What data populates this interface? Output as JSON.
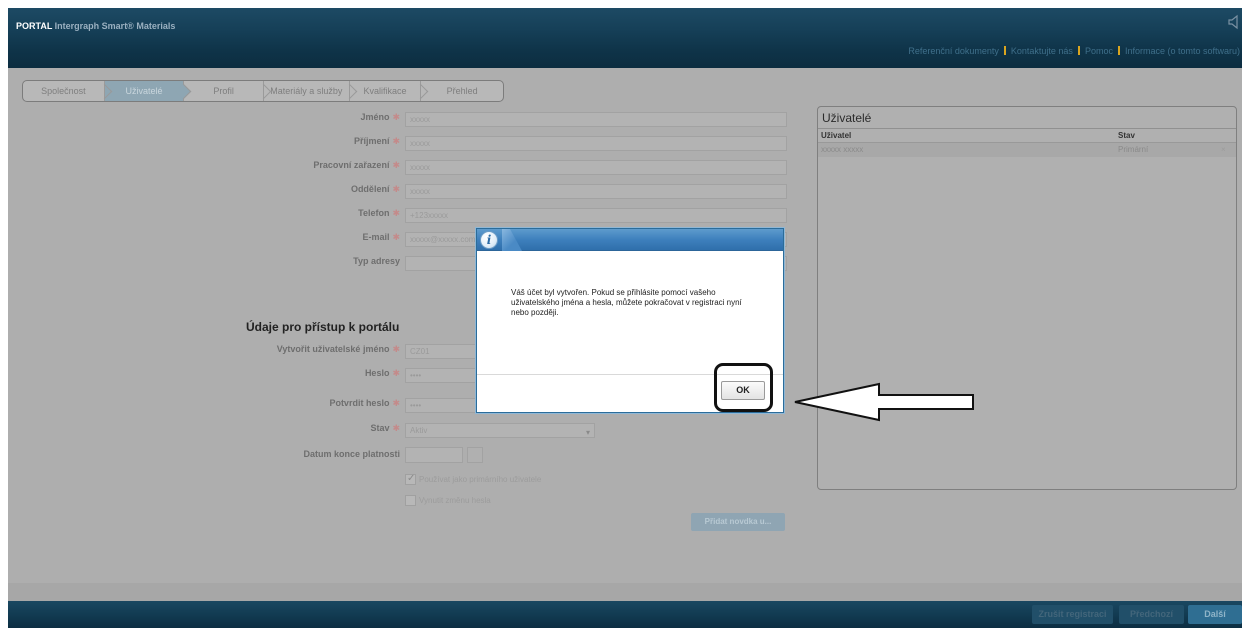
{
  "header": {
    "brand_prefix": "PORTAL",
    "brand_rest": " Intergraph Smart® Materials",
    "links": [
      "Referenční dokumenty",
      "Kontaktujte nás",
      "Pomoc",
      "Informace (o tomto softwaru)"
    ],
    "icon": "speaker-icon"
  },
  "wizard": {
    "steps": [
      "Společnost",
      "Uživatelé",
      "Profil",
      "Materiály a služby",
      "Kvalifikace",
      "Přehled"
    ],
    "active": "Uživatelé"
  },
  "form": {
    "fields": [
      {
        "label": "Jméno",
        "required": true,
        "placeholder": "xxxxx"
      },
      {
        "label": "Příjmení",
        "required": true,
        "placeholder": "xxxxx"
      },
      {
        "label": "Pracovní zařazení",
        "required": true,
        "placeholder": "xxxxx"
      },
      {
        "label": "Oddělení",
        "required": true,
        "placeholder": "xxxxx"
      },
      {
        "label": "Telefon",
        "required": true,
        "placeholder": "+123xxxxx"
      },
      {
        "label": "E-mail",
        "required": true,
        "placeholder": "xxxxx@xxxxx.com"
      },
      {
        "label": "Typ adresy",
        "required": false,
        "placeholder": ""
      }
    ],
    "access_section_title": "Údaje pro přístup k portálu",
    "access_fields": [
      {
        "label": "Vytvořit uživatelské jméno",
        "required": true,
        "placeholder": "CZ01"
      },
      {
        "label": "Heslo",
        "required": true,
        "placeholder": "••••"
      },
      {
        "label": "Potvrdit heslo",
        "required": true,
        "placeholder": "••••"
      },
      {
        "label": "Stav",
        "required": true,
        "placeholder": "Aktiv"
      },
      {
        "label": "Datum konce platnosti",
        "required": false,
        "placeholder": ""
      }
    ],
    "checkboxes": [
      {
        "label": "Používat jako primárního uživatele",
        "checked": true
      },
      {
        "label": "Vynutit změnu hesla",
        "checked": false
      }
    ],
    "add_button": "Přidat novdka u..."
  },
  "users_panel": {
    "title": "Uživatelé",
    "columns": [
      "Uživatel",
      "Stav"
    ],
    "rows": [
      {
        "user": "xxxxx xxxxx",
        "state": "Primární"
      }
    ]
  },
  "dialog": {
    "icon": "info-icon",
    "message": "Váš účet byl vytvořen. Pokud se přihlásite pomocí vašeho uživatelského jména a hesla, můžete pokračovat v registraci nyní nebo později.",
    "ok_label": "OK"
  },
  "footer": {
    "buttons": [
      "Zrušit registraci",
      "Předchozí",
      "Další"
    ]
  },
  "colors": {
    "header_bg": "#123b52",
    "overlay_gray": "#aeaeae",
    "dialog_title_blue": "#3e80bd",
    "toplink_separator": "#d9a520"
  }
}
